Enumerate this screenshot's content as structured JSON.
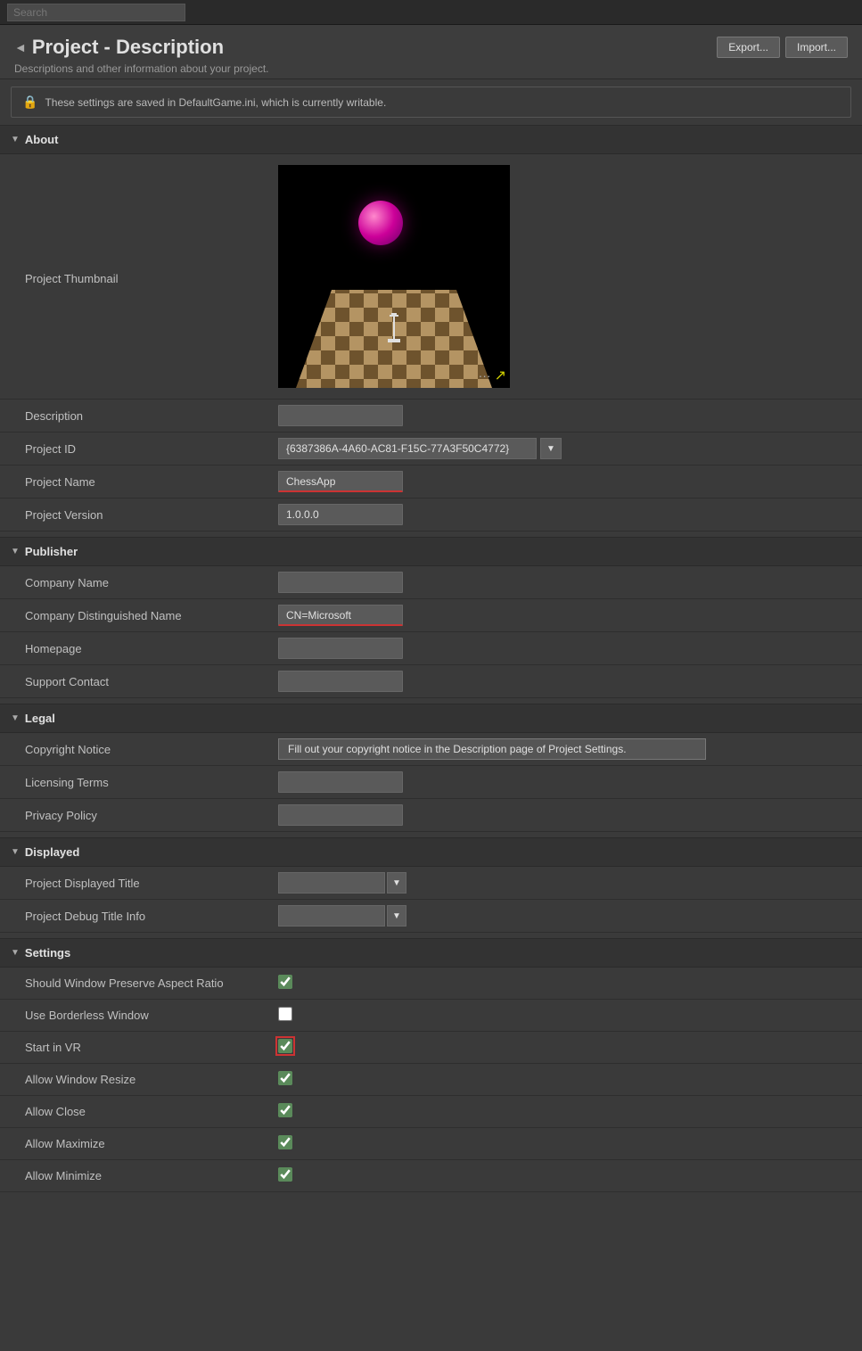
{
  "topbar": {
    "search_placeholder": "Search"
  },
  "header": {
    "triangle": "◄",
    "title": "Project - Description",
    "subtitle": "Descriptions and other information about your project.",
    "export_label": "Export...",
    "import_label": "Import..."
  },
  "infobar": {
    "message": "These settings are saved in DefaultGame.ini, which is currently writable."
  },
  "sections": {
    "about": {
      "label": "About",
      "triangle": "▼",
      "fields": {
        "thumbnail_label": "Project Thumbnail",
        "description_label": "Description",
        "description_value": "",
        "project_id_label": "Project ID",
        "project_id_value": "{6387386A-4A60-AC81-F15C-77A3F50C4772}",
        "project_name_label": "Project Name",
        "project_name_value": "ChessApp",
        "project_version_label": "Project Version",
        "project_version_value": "1.0.0.0"
      }
    },
    "publisher": {
      "label": "Publisher",
      "triangle": "▼",
      "fields": {
        "company_name_label": "Company Name",
        "company_name_value": "",
        "company_dn_label": "Company Distinguished Name",
        "company_dn_value": "CN=Microsoft",
        "homepage_label": "Homepage",
        "homepage_value": "",
        "support_label": "Support Contact",
        "support_value": ""
      }
    },
    "legal": {
      "label": "Legal",
      "triangle": "▼",
      "fields": {
        "copyright_label": "Copyright Notice",
        "copyright_tooltip": "Fill out your copyright notice in the Description page of Project Settings.",
        "licensing_label": "Licensing Terms",
        "licensing_value": "",
        "privacy_label": "Privacy Policy",
        "privacy_value": ""
      }
    },
    "displayed": {
      "label": "Displayed",
      "triangle": "▼",
      "fields": {
        "displayed_title_label": "Project Displayed Title",
        "displayed_title_value": "",
        "debug_title_label": "Project Debug Title Info",
        "debug_title_value": ""
      }
    },
    "settings": {
      "label": "Settings",
      "triangle": "▼",
      "fields": {
        "aspect_ratio_label": "Should Window Preserve Aspect Ratio",
        "aspect_ratio_checked": true,
        "borderless_label": "Use Borderless Window",
        "borderless_checked": false,
        "start_vr_label": "Start in VR",
        "start_vr_checked": true,
        "allow_resize_label": "Allow Window Resize",
        "allow_resize_checked": true,
        "allow_close_label": "Allow Close",
        "allow_close_checked": true,
        "allow_maximize_label": "Allow Maximize",
        "allow_maximize_checked": true,
        "allow_minimize_label": "Allow Minimize",
        "allow_minimize_checked": true
      }
    }
  },
  "icons": {
    "lock": "🔒",
    "triangle_down": "▼",
    "triangle_right": "▶",
    "ellipsis": "···",
    "arrow_right": "↗"
  }
}
